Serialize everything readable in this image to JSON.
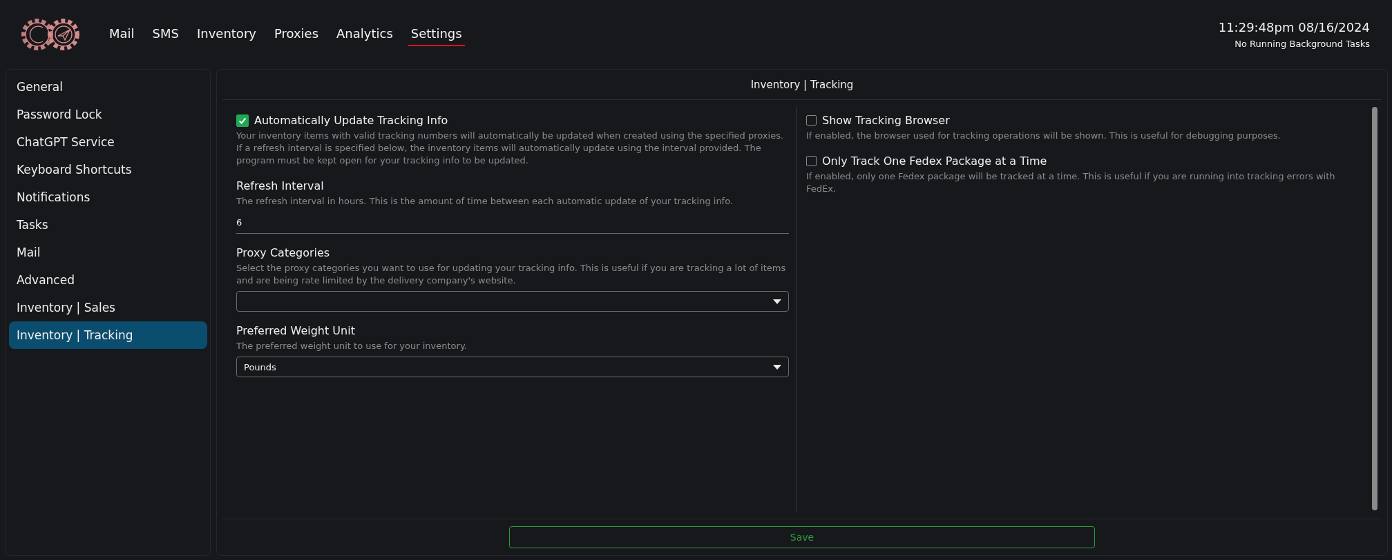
{
  "nav": {
    "items": [
      {
        "label": "Mail",
        "selected": false
      },
      {
        "label": "SMS",
        "selected": false
      },
      {
        "label": "Inventory",
        "selected": false
      },
      {
        "label": "Proxies",
        "selected": false
      },
      {
        "label": "Analytics",
        "selected": false
      },
      {
        "label": "Settings",
        "selected": true
      }
    ]
  },
  "status": {
    "clock": "11:29:48pm 08/16/2024",
    "tasks": "No Running Background Tasks"
  },
  "sidebar": {
    "items": [
      {
        "label": "General",
        "selected": false
      },
      {
        "label": "Password Lock",
        "selected": false
      },
      {
        "label": "ChatGPT Service",
        "selected": false
      },
      {
        "label": "Keyboard Shortcuts",
        "selected": false
      },
      {
        "label": "Notifications",
        "selected": false
      },
      {
        "label": "Tasks",
        "selected": false
      },
      {
        "label": "Mail",
        "selected": false
      },
      {
        "label": "Advanced",
        "selected": false
      },
      {
        "label": "Inventory | Sales",
        "selected": false
      },
      {
        "label": "Inventory | Tracking",
        "selected": true
      }
    ]
  },
  "panel": {
    "title": "Inventory | Tracking",
    "left": [
      {
        "kind": "checkbox",
        "label": "Automatically Update Tracking Info",
        "checked": true,
        "description": "Your inventory items with valid tracking numbers will automatically be updated when created using the specified proxies. If a refresh interval is specified below, the inventory items will automatically update using the interval provided. The program must be kept open for your tracking info to be updated."
      },
      {
        "kind": "number",
        "label": "Refresh Interval",
        "description": "The refresh interval in hours. This is the amount of time between each automatic update of your tracking info.",
        "value": "6"
      },
      {
        "kind": "select",
        "label": "Proxy Categories",
        "description": "Select the proxy categories you want to use for updating your tracking info. This is useful if you are tracking a lot of items and are being rate limited by the delivery company's website."
      },
      {
        "kind": "select",
        "label": "Preferred Weight Unit",
        "description": "The preferred weight unit to use for your inventory.",
        "value": "Pounds"
      }
    ],
    "right": [
      {
        "kind": "checkbox",
        "label": "Show Tracking Browser",
        "checked": false,
        "description": "If enabled, the browser used for tracking operations will be shown. This is useful for debugging purposes."
      },
      {
        "kind": "checkbox",
        "label": "Only Track One Fedex Package at a Time",
        "checked": false,
        "description": "If enabled, only one Fedex package will be tracked at a time. This is useful if you are running into tracking errors with FedEx."
      }
    ],
    "save_button": "Save"
  }
}
